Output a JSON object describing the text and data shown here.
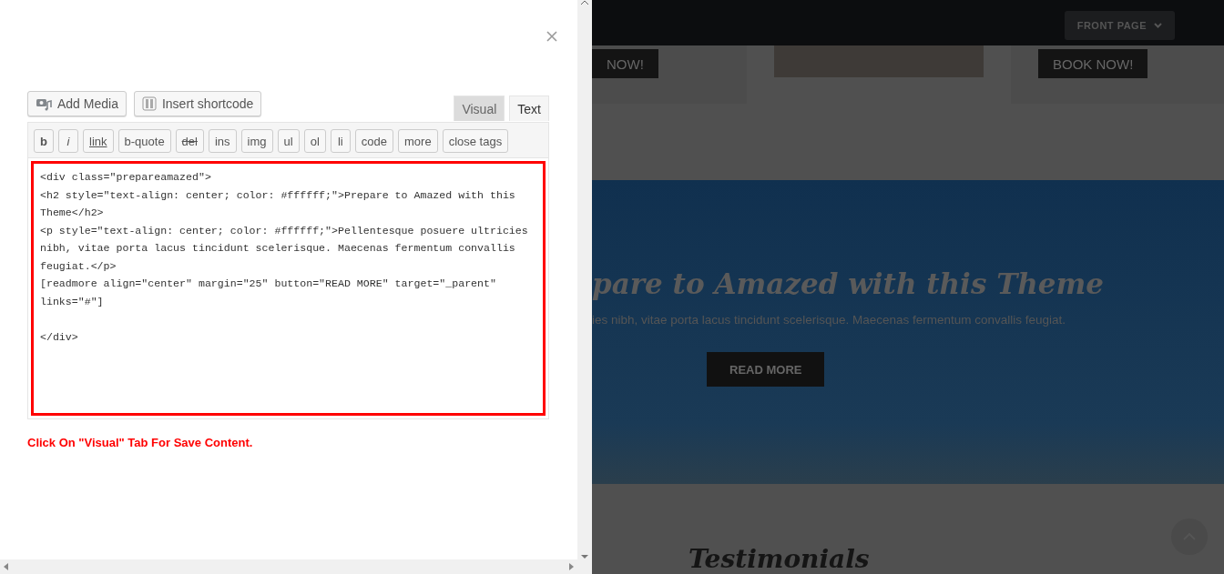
{
  "editor_panel": {
    "media_buttons": [
      {
        "kind": "media",
        "label": "Add Media"
      },
      {
        "kind": "shortcode",
        "label": "Insert shortcode"
      }
    ],
    "tabs": [
      {
        "label": "Visual",
        "selected": false
      },
      {
        "label": "Text",
        "selected": true
      }
    ],
    "quicktags": [
      {
        "label": "b",
        "kind": "bold"
      },
      {
        "label": "i",
        "kind": "italic"
      },
      {
        "label": "link",
        "kind": "underline"
      },
      {
        "label": "b-quote",
        "kind": "plain"
      },
      {
        "label": "del",
        "kind": "strike"
      },
      {
        "label": "ins",
        "kind": "plain"
      },
      {
        "label": "img",
        "kind": "plain"
      },
      {
        "label": "ul",
        "kind": "plain"
      },
      {
        "label": "ol",
        "kind": "plain"
      },
      {
        "label": "li",
        "kind": "plain"
      },
      {
        "label": "code",
        "kind": "plain"
      },
      {
        "label": "more",
        "kind": "plain"
      },
      {
        "label": "close tags",
        "kind": "plain"
      }
    ],
    "content": "<div class=\"prepareamazed\">\n<h2 style=\"text-align: center; color: #ffffff;\">Prepare to Amazed with this\nTheme</h2>\n<p style=\"text-align: center; color: #ffffff;\">Pellentesque posuere ultricies\nnibh, vitae porta lacus tincidunt scelerisque. Maecenas fermentum convallis\nfeugiat.</p>\n[readmore align=\"center\" margin=\"25\" button=\"READ MORE\" target=\"_parent\"\nlinks=\"#\"]\n\n</div>",
    "notice": "Click On \"Visual\" Tab For Save Content."
  },
  "website": {
    "menu_button": "FRONT PAGE",
    "card_buttons": [
      "NOW!",
      "BOOK NOW!"
    ],
    "hero_title": "pare to Amazed with this Theme",
    "hero_text": "ies nibh, vitae porta lacus tincidunt scelerisque. Maecenas fermentum convallis feugiat.",
    "hero_button": "READ MORE",
    "section_title": "Testimonials"
  }
}
